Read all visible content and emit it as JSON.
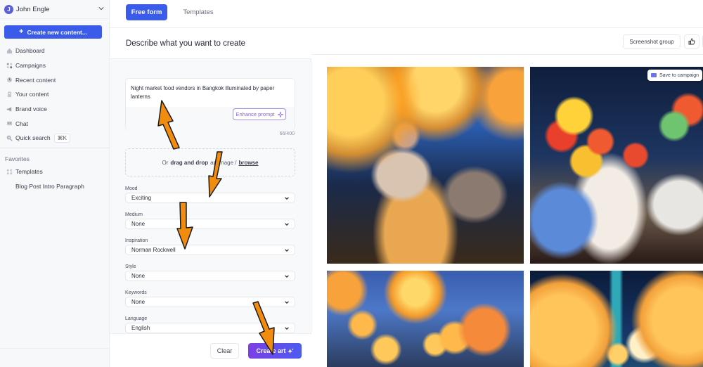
{
  "sidebar": {
    "user": {
      "initial": "J",
      "name": "John Engle"
    },
    "create_button": "Create new content...",
    "nav": [
      {
        "label": "Dashboard",
        "icon": "home-icon"
      },
      {
        "label": "Campaigns",
        "icon": "campaigns-icon"
      },
      {
        "label": "Recent content",
        "icon": "clock-icon"
      },
      {
        "label": "Your content",
        "icon": "lock-icon"
      },
      {
        "label": "Brand voice",
        "icon": "megaphone-icon"
      },
      {
        "label": "Chat",
        "icon": "chat-icon"
      },
      {
        "label": "Quick search",
        "icon": "search-icon",
        "shortcut": "⌘K"
      }
    ],
    "favorites_label": "Favorites",
    "favorites": [
      {
        "label": "Templates",
        "icon": "grid-icon"
      },
      {
        "label": "Blog Post Intro Paragraph"
      }
    ]
  },
  "tabs": [
    {
      "label": "Free form",
      "active": true
    },
    {
      "label": "Templates",
      "active": false
    }
  ],
  "form": {
    "title": "Describe what you want to create",
    "prompt": "Night market food vendors in Bangkok illuminated by paper lanterns",
    "enhance_label": "Enhance prompt",
    "char_count": "66/400",
    "dropzone": {
      "prefix": "Or",
      "bold": "drag and drop",
      "middle": "an image /",
      "link": "browse"
    },
    "fields": [
      {
        "label": "Mood",
        "value": "Exciting"
      },
      {
        "label": "Medium",
        "value": "None"
      },
      {
        "label": "Inspiration",
        "value": "Norman Rockwell"
      },
      {
        "label": "Style",
        "value": "None"
      },
      {
        "label": "Keywords",
        "value": "None"
      },
      {
        "label": "Language",
        "value": "English"
      }
    ],
    "clear_label": "Clear",
    "create_label": "Create art"
  },
  "results": {
    "screenshot_group_label": "Screenshot group",
    "save_to_campaign_label": "Save to campaign",
    "images": [
      {
        "alt": "Night market vendor serving food under orange paper lanterns"
      },
      {
        "alt": "Illustrated diners at a table under colorful lanterns"
      },
      {
        "alt": "Orange paper lanterns against a blue evening sky"
      },
      {
        "alt": "Glowing lanterns in front of a Bangkok skyscraper at night"
      }
    ]
  },
  "colors": {
    "accent": "#3b5bea",
    "create_gradient_start": "#7b3fe4",
    "enhance": "#8a63d9",
    "annotation_arrow": "#f28c0f"
  }
}
